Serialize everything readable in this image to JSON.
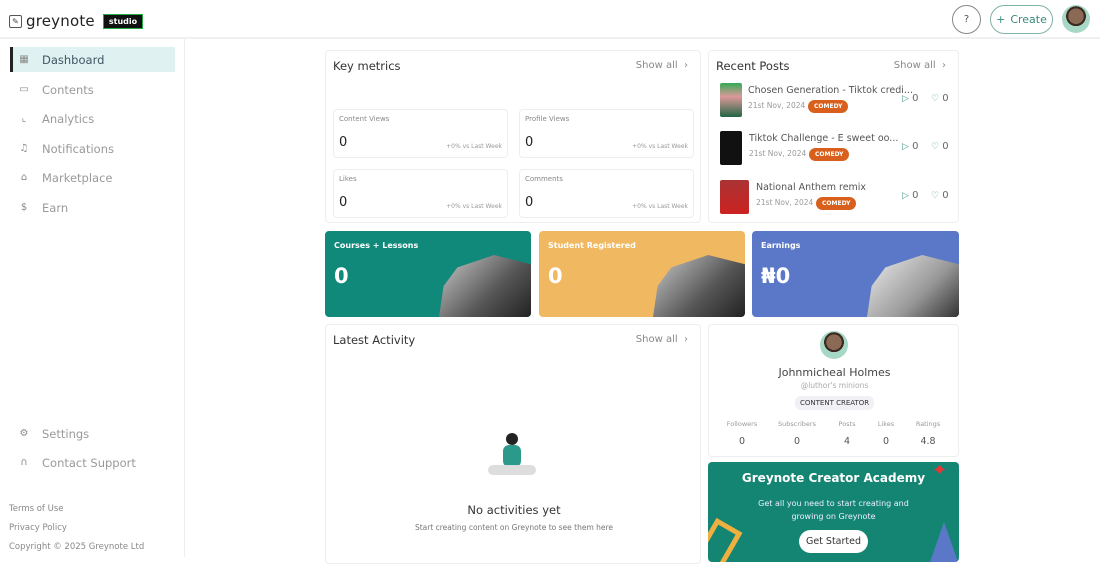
{
  "header": {
    "logo": "greynote",
    "logo_badge": "studio",
    "help_label": "?",
    "create_label": "Create"
  },
  "sidebar": {
    "items": [
      {
        "label": "Dashboard",
        "icon": "grid-icon"
      },
      {
        "label": "Contents",
        "icon": "folder-icon"
      },
      {
        "label": "Analytics",
        "icon": "chart-icon"
      },
      {
        "label": "Notifications",
        "icon": "bell-icon"
      },
      {
        "label": "Marketplace",
        "icon": "store-icon"
      },
      {
        "label": "Earn",
        "icon": "dollar-icon"
      }
    ],
    "bottom_items": [
      {
        "label": "Settings",
        "icon": "gear-icon"
      },
      {
        "label": "Contact Support",
        "icon": "headset-icon"
      }
    ],
    "footer": {
      "terms": "Terms of Use",
      "privacy": "Privacy Policy",
      "copyright": "Copyright © 2025 Greynote Ltd"
    }
  },
  "key_metrics": {
    "title": "Key metrics",
    "show_all": "Show all",
    "metrics": [
      {
        "label": "Content Views",
        "value": "0",
        "change": "+0% vs Last Week"
      },
      {
        "label": "Profile Views",
        "value": "0",
        "change": "+0% vs Last Week"
      },
      {
        "label": "Likes",
        "value": "0",
        "change": "+0% vs Last Week"
      },
      {
        "label": "Comments",
        "value": "0",
        "change": "+0% vs Last Week"
      }
    ]
  },
  "recent_posts": {
    "title": "Recent Posts",
    "show_all": "Show all",
    "posts": [
      {
        "title": "Chosen Generation - Tiktok credi...",
        "date": "21st Nov, 2024",
        "category": "COMEDY",
        "plays": "0",
        "likes": "0"
      },
      {
        "title": "Tiktok Challenge - E sweet oo...",
        "date": "21st Nov, 2024",
        "category": "COMEDY",
        "plays": "0",
        "likes": "0"
      },
      {
        "title": "National Anthem remix",
        "date": "21st Nov, 2024",
        "category": "COMEDY",
        "plays": "0",
        "likes": "0"
      }
    ]
  },
  "banners": [
    {
      "title": "Courses + Lessons",
      "value": "0",
      "color": "#10887a"
    },
    {
      "title": "Student Registered",
      "value": "0",
      "color": "#f0b860"
    },
    {
      "title": "Earnings",
      "value": "₦0",
      "color": "#5b78c8"
    }
  ],
  "latest_activity": {
    "title": "Latest Activity",
    "show_all": "Show all",
    "empty_title": "No activities yet",
    "empty_text": "Start creating content on Greynote to see them here"
  },
  "profile": {
    "name": "Johnmicheal Holmes",
    "handle": "@luthor's minions",
    "role": "CONTENT CREATOR",
    "stats": [
      {
        "label": "Followers",
        "value": "0"
      },
      {
        "label": "Subscribers",
        "value": "0"
      },
      {
        "label": "Posts",
        "value": "4"
      },
      {
        "label": "Likes",
        "value": "0"
      },
      {
        "label": "Ratings",
        "value": "4.8"
      }
    ]
  },
  "academy": {
    "title": "Greynote Creator Academy",
    "text": "Get all you need to start creating and growing on Greynote",
    "button": "Get Started"
  }
}
